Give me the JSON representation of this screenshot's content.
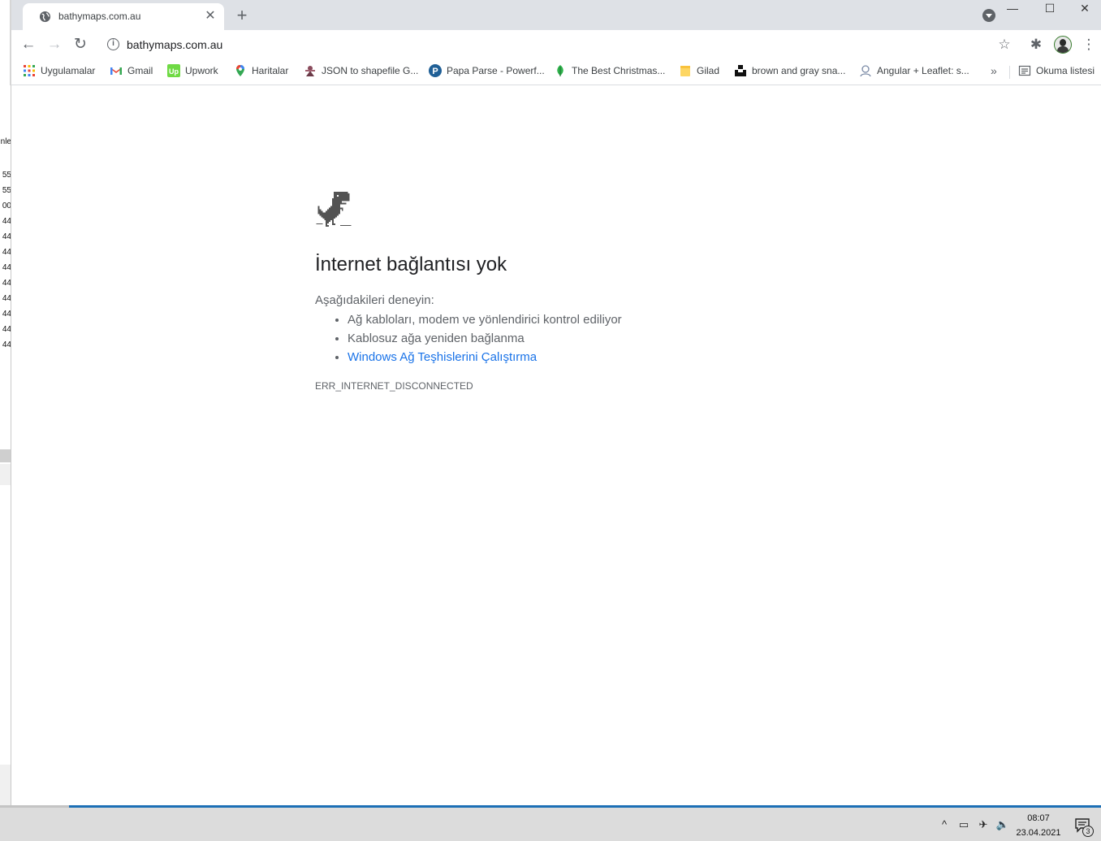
{
  "browser": {
    "tab": {
      "title": "bathymaps.com.au",
      "close_glyph": "✕"
    },
    "new_tab_glyph": "+",
    "window_controls": {
      "minimize": "—",
      "maximize": "☐",
      "close": "✕"
    },
    "toolbar": {
      "back_glyph": "←",
      "forward_glyph": "→",
      "reload_glyph": "↻",
      "url": "bathymaps.com.au",
      "info_glyph": "i",
      "star_glyph": "☆",
      "extensions_glyph": "✱",
      "menu_glyph": "⋮"
    },
    "bookmarks": [
      {
        "label": "Uygulamalar",
        "icon": "apps-grid-icon"
      },
      {
        "label": "Gmail",
        "icon": "gmail-icon"
      },
      {
        "label": "Upwork",
        "icon": "upwork-icon"
      },
      {
        "label": "Haritalar",
        "icon": "maps-pin-icon"
      },
      {
        "label": "JSON to shapefile G...",
        "icon": "json-shapefile-icon"
      },
      {
        "label": "Papa Parse - Powerf...",
        "icon": "papaparse-icon"
      },
      {
        "label": "The Best Christmas...",
        "icon": "leaf-icon"
      },
      {
        "label": "Gilad",
        "icon": "folder-icon"
      },
      {
        "label": "brown and gray sna...",
        "icon": "unsplash-icon"
      },
      {
        "label": "Angular + Leaflet: s...",
        "icon": "profile-icon"
      }
    ],
    "bookmarks_more": "»",
    "reading_list": {
      "label": "Okuma listesi",
      "icon": "reading-list-icon"
    }
  },
  "error_page": {
    "title": "İnternet bağlantısı yok",
    "try_label": "Aşağıdakileri deneyin:",
    "suggestions": [
      "Ağ kabloları, modem ve yönlendirici kontrol ediliyor",
      "Kablosuz ağa yeniden bağlanma"
    ],
    "diagnostics_link": "Windows Ağ Teşhislerini Çalıştırma",
    "error_code": "ERR_INTERNET_DISCONNECTED"
  },
  "background_window": {
    "fragments": [
      "nle",
      "55",
      "55",
      "00",
      "44",
      "44",
      "44",
      "44",
      "44",
      "44",
      "44",
      "44",
      "44"
    ]
  },
  "taskbar": {
    "time": "08:07",
    "date": "23.04.2021",
    "notification_count": "3",
    "tray": {
      "chevron": "^",
      "battery": "▭",
      "airplane": "✈",
      "volume": "🔈"
    }
  },
  "colors": {
    "link": "#1a73e8",
    "tabstrip": "#dee1e6",
    "taskbar_accent": "#1c6fb5"
  }
}
